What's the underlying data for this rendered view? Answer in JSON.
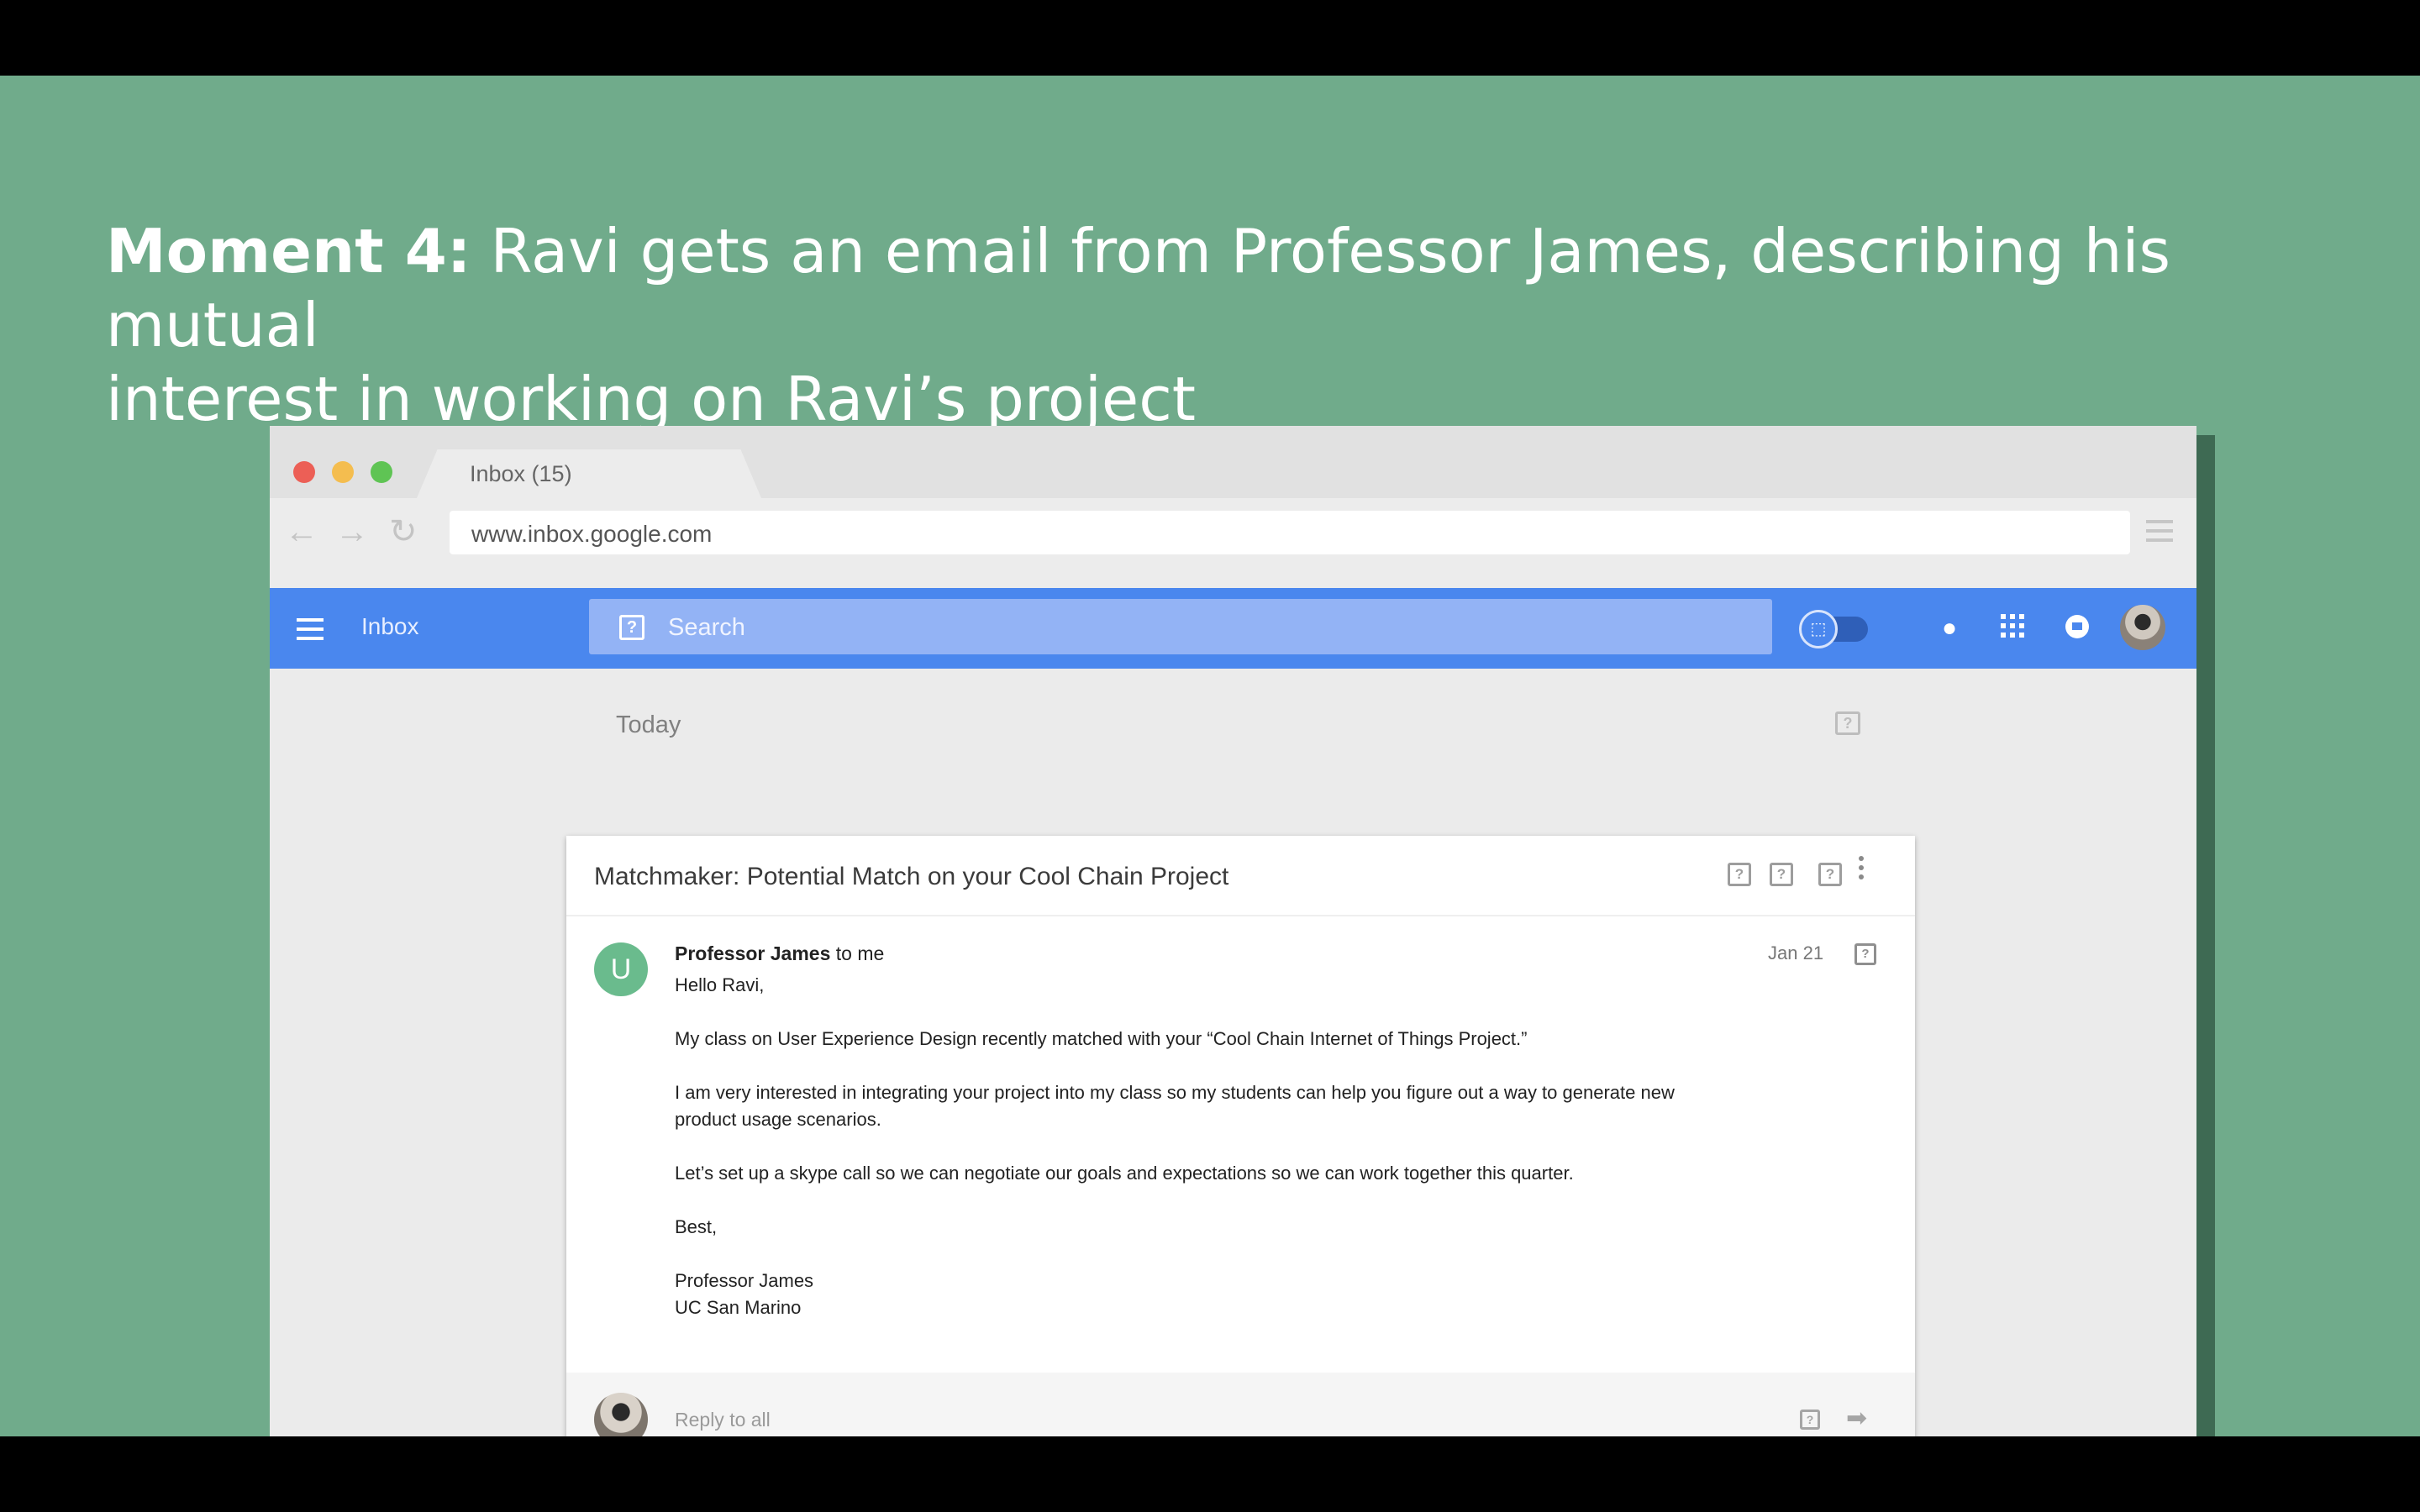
{
  "caption": {
    "bold": "Moment 4:",
    "line1": " Ravi gets an email from Professor James, describing his mutual",
    "line2": "interest in working on Ravi’s project"
  },
  "browser": {
    "tab_title": "Inbox (15)",
    "url": "www.inbox.google.com",
    "traffic_colors": [
      "#ec5f56",
      "#f4bd4f",
      "#5fc454"
    ]
  },
  "appbar": {
    "title": "Inbox",
    "search_placeholder": "Search",
    "accent": "#4a87ee"
  },
  "section": {
    "label": "Today"
  },
  "email": {
    "subject": "Matchmaker: Potential Match on your Cool Chain Project",
    "sender_initial": "U",
    "sender_name": "Professor James",
    "recipient": " to me",
    "date": "Jan 21",
    "body": [
      "Hello Ravi,",
      "My class on User Experience Design recently matched with your “Cool Chain Internet of Things Project.”",
      "I am very interested in integrating your project into my class so my students can help you figure out a way to generate new",
      "product usage scenarios.",
      "Let’s set up a skype call so we can negotiate our goals and expectations so we can work together this quarter.",
      "Best,",
      "Professor James",
      "UC San Marino"
    ],
    "reply_label": "Reply to all"
  },
  "colors": {
    "slide_background": "#70ab8b",
    "sender_avatar": "#6abb8d"
  }
}
